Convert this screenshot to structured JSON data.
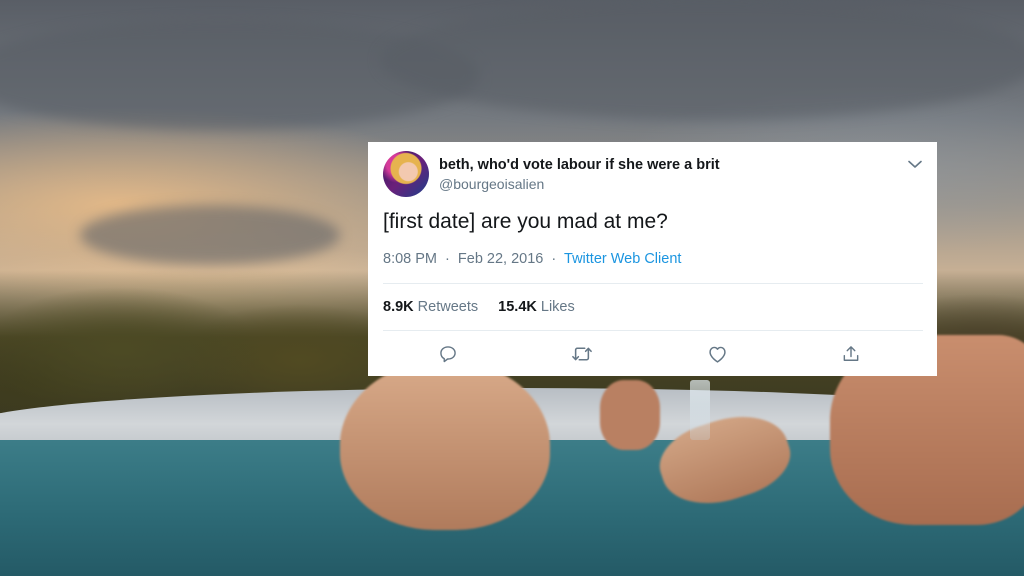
{
  "tweet": {
    "display_name": "beth, who'd vote labour if she were a brit",
    "handle": "@bourgeoisalien",
    "text": "[first date] are you mad at me?",
    "time": "8:08 PM",
    "date": "Feb 22, 2016",
    "separator": "·",
    "client": "Twitter Web Client",
    "stats": {
      "retweets_count": "8.9K",
      "retweets_label": "Retweets",
      "likes_count": "15.4K",
      "likes_label": "Likes"
    },
    "actions": [
      {
        "name": "reply-icon"
      },
      {
        "name": "retweet-icon"
      },
      {
        "name": "like-icon"
      },
      {
        "name": "share-icon"
      }
    ]
  },
  "colors": {
    "text_primary": "#14171a",
    "text_secondary": "#657786",
    "link": "#1b95e0",
    "icon": "#657786"
  }
}
